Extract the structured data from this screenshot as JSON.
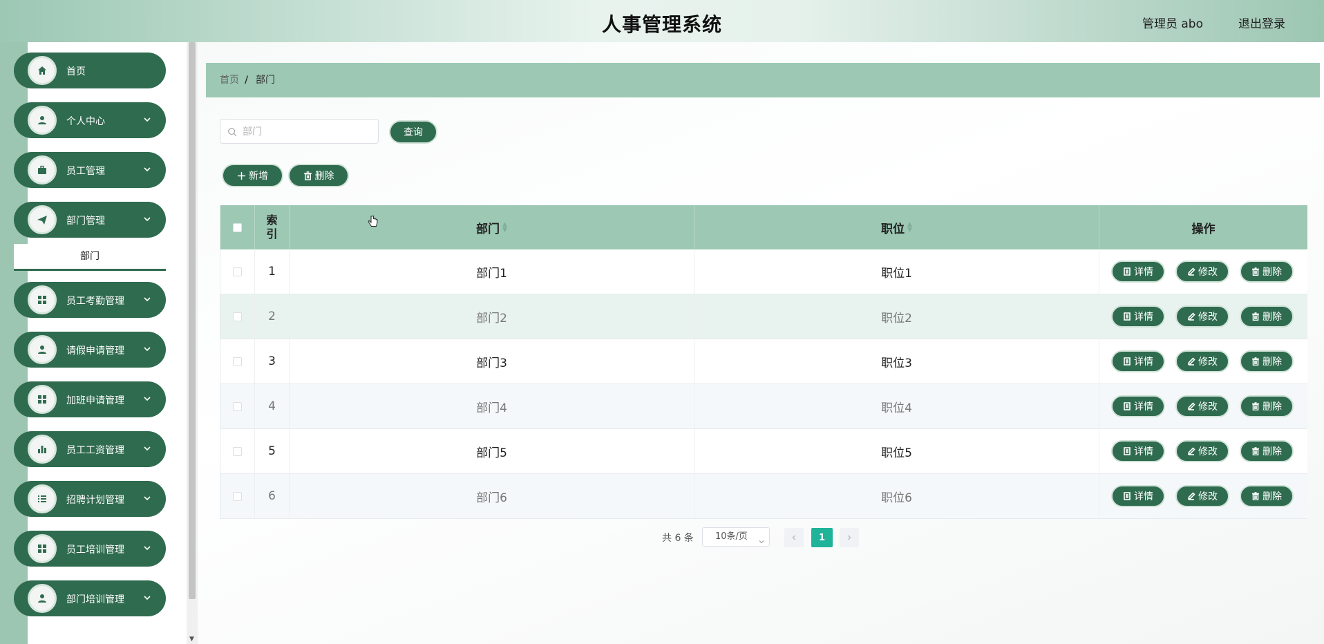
{
  "header": {
    "title": "人事管理系统",
    "user": "管理员 abo",
    "logout": "退出登录"
  },
  "sidebar": {
    "items": [
      {
        "label": "首页",
        "icon": "home-icon",
        "has_children": false
      },
      {
        "label": "个人中心",
        "icon": "user-icon",
        "has_children": true
      },
      {
        "label": "员工管理",
        "icon": "briefcase-icon",
        "has_children": true
      },
      {
        "label": "部门管理",
        "icon": "send-icon",
        "has_children": true,
        "children": [
          "部门"
        ]
      },
      {
        "label": "员工考勤管理",
        "icon": "grid-icon",
        "has_children": true
      },
      {
        "label": "请假申请管理",
        "icon": "user-icon",
        "has_children": true
      },
      {
        "label": "加班申请管理",
        "icon": "grid-icon",
        "has_children": true
      },
      {
        "label": "员工工资管理",
        "icon": "bar-chart-icon",
        "has_children": true
      },
      {
        "label": "招聘计划管理",
        "icon": "list-icon",
        "has_children": true
      },
      {
        "label": "员工培训管理",
        "icon": "grid-icon",
        "has_children": true
      },
      {
        "label": "部门培训管理",
        "icon": "user-icon",
        "has_children": true
      }
    ]
  },
  "breadcrumb": {
    "home": "首页",
    "separator": "/",
    "current": "部门"
  },
  "search": {
    "placeholder": "部门",
    "value": "",
    "button": "查询"
  },
  "toolbar": {
    "add": "新增",
    "delete": "删除"
  },
  "table": {
    "headers": {
      "index": "索引",
      "dept": "部门",
      "position": "职位",
      "actions": "操作"
    },
    "rows": [
      {
        "index": "1",
        "dept": "部门1",
        "position": "职位1"
      },
      {
        "index": "2",
        "dept": "部门2",
        "position": "职位2"
      },
      {
        "index": "3",
        "dept": "部门3",
        "position": "职位3"
      },
      {
        "index": "4",
        "dept": "部门4",
        "position": "职位4"
      },
      {
        "index": "5",
        "dept": "部门5",
        "position": "职位5"
      },
      {
        "index": "6",
        "dept": "部门6",
        "position": "职位6"
      }
    ],
    "actions": {
      "detail": "详情",
      "edit": "修改",
      "delete": "删除"
    }
  },
  "pagination": {
    "total": "共 6 条",
    "page_size": "10条/页",
    "current_page": "1"
  },
  "colors": {
    "primary": "#2f6b4f",
    "header_bg": "#9cc8b4",
    "active_page": "#1fb39a"
  }
}
